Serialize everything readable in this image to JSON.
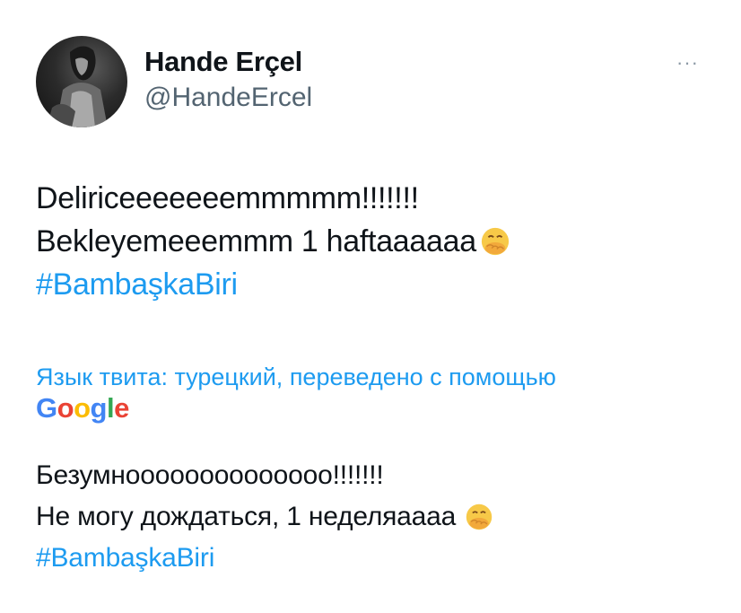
{
  "author": {
    "display_name": "Hande Erçel",
    "handle": "@HandeErcel"
  },
  "more_icon": "more-horizontal-icon",
  "tweet": {
    "line1": "Deliriceeeeeeemmmmm!!!!!!!",
    "line2": "Bekleyemeeemmm 1 haftaaaaaa",
    "hashtag": "#BambaşkaBiri",
    "emoji": "face-with-hand-over-mouth-emoji"
  },
  "translation": {
    "note": "Язык твита: турецкий, переведено с помощью",
    "provider_logo": "Google",
    "line1": "Безумноооооооооооооо!!!!!!!",
    "line2": "Не могу дождаться, 1 неделяаааа",
    "hashtag": "#BambaşkaBiri"
  },
  "colors": {
    "link": "#1d9bf0",
    "text": "#0f1419",
    "secondary": "#536471"
  }
}
